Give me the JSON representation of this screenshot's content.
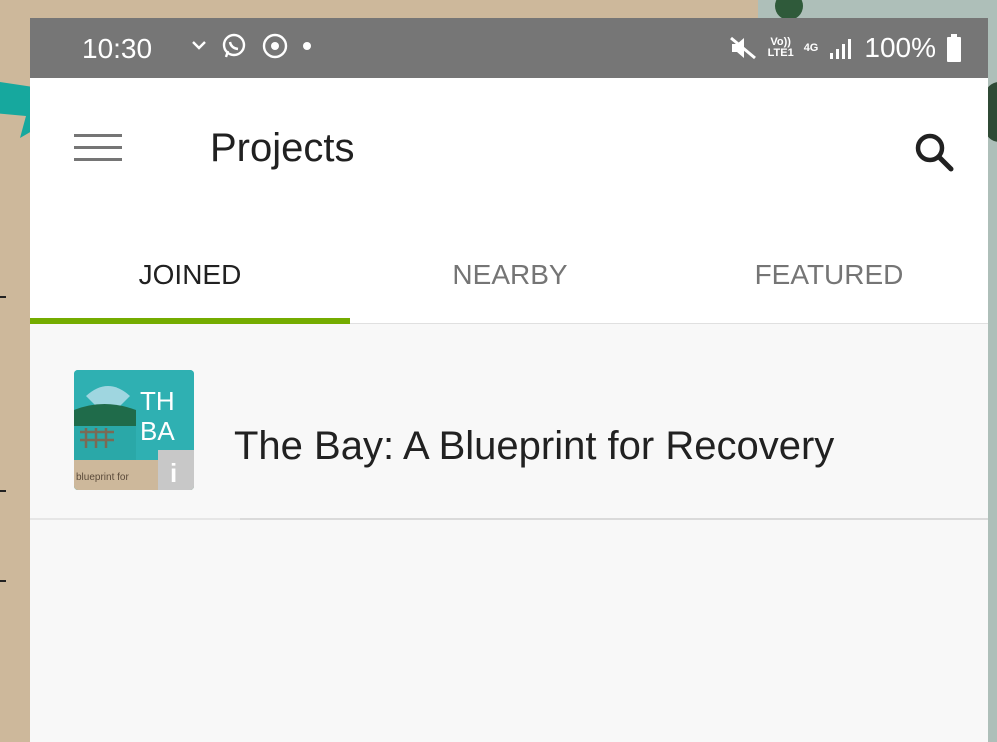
{
  "status_bar": {
    "time": "10:30",
    "battery_percent": "100%",
    "network_badge_top": "Vo))",
    "network_badge_bottom": "LTE1",
    "network_type": "4G",
    "icons": [
      "arrow-down-icon",
      "whatsapp-icon",
      "chrome-icon",
      "dot-icon",
      "mute-icon",
      "signal-icon",
      "battery-icon"
    ]
  },
  "app_bar": {
    "title": "Projects",
    "menu_icon": "hamburger-icon",
    "search_icon": "search-icon"
  },
  "tabs": [
    {
      "label": "JOINED",
      "active": true
    },
    {
      "label": "NEARBY",
      "active": false
    },
    {
      "label": "FEATURED",
      "active": false
    }
  ],
  "projects": [
    {
      "name": "The Bay: A Blueprint for Recovery",
      "thumbnail": {
        "line1": "TH",
        "line2": "BA",
        "caption": "blueprint for",
        "info_glyph": "i"
      }
    }
  ],
  "colors": {
    "status_bar": "#767676",
    "tab_indicator": "#74ac00",
    "background": "#f8f8f8",
    "outer_left": "#cdb89b",
    "outer_right": "#aebfb9",
    "arrow": "#16a89e"
  }
}
